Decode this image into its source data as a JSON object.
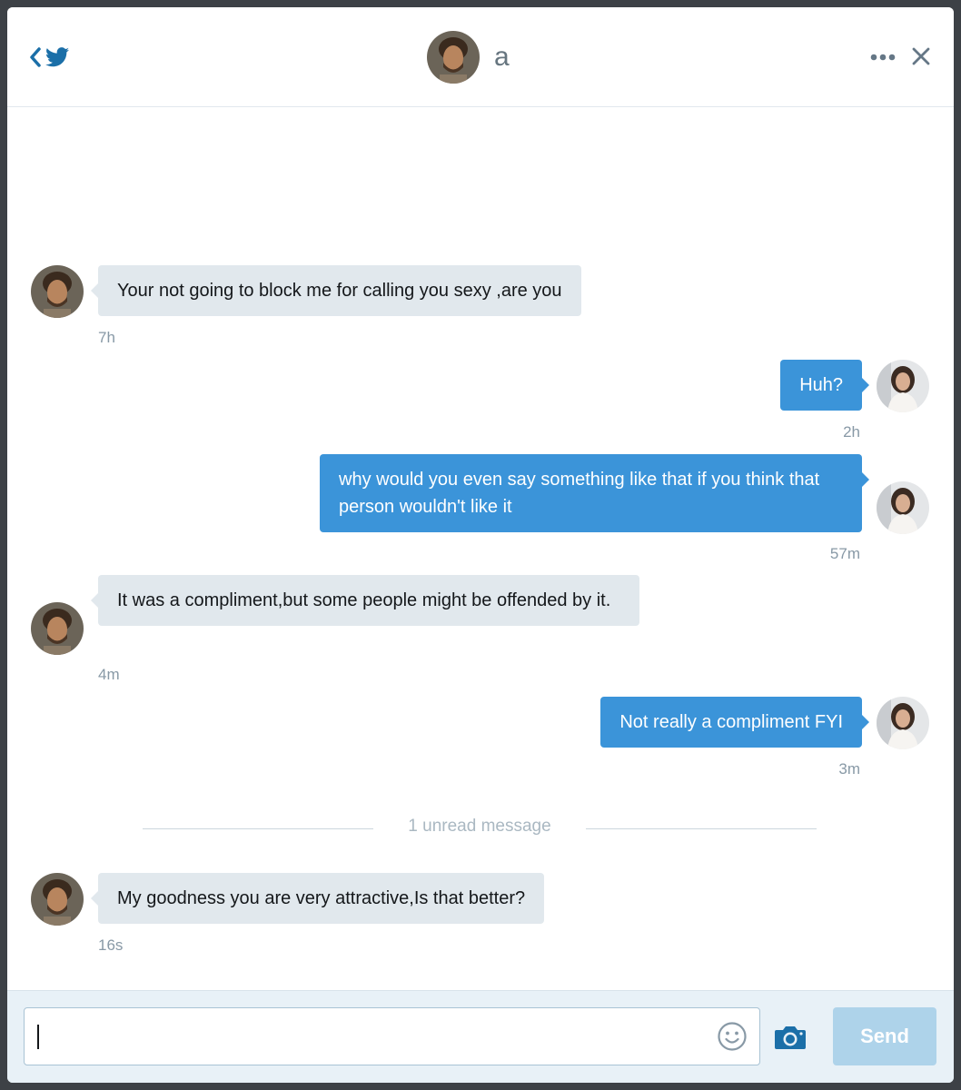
{
  "header": {
    "back_icon": "chevron-left-icon",
    "logo_icon": "twitter-bird-icon",
    "contact_name": "a",
    "more_icon": "ellipsis-icon",
    "close_icon": "close-icon"
  },
  "messages": [
    {
      "direction": "in",
      "text": "Your not going to block me for calling you sexy ,are you",
      "time": "7h"
    },
    {
      "direction": "out",
      "text": "Huh?",
      "time": "2h"
    },
    {
      "direction": "out",
      "text": "why would you even say something like that if you think that person wouldn't like it",
      "time": "57m"
    },
    {
      "direction": "in",
      "text": "It was a compliment,but some people might be offended by it.",
      "time": "4m"
    },
    {
      "direction": "out",
      "text": "Not really a compliment FYI",
      "time": "3m"
    },
    {
      "direction": "in",
      "text": "My goodness you are very attractive,Is that better?",
      "time": "16s"
    }
  ],
  "unread_divider": "1 unread message",
  "composer": {
    "input_value": "",
    "emoji_icon": "smiley-icon",
    "camera_icon": "camera-icon",
    "send_label": "Send"
  },
  "colors": {
    "accent": "#3b94d9",
    "incoming_bubble": "#e1e8ed",
    "send_disabled": "#aed3ea",
    "icon_blue": "#1b95e0"
  }
}
